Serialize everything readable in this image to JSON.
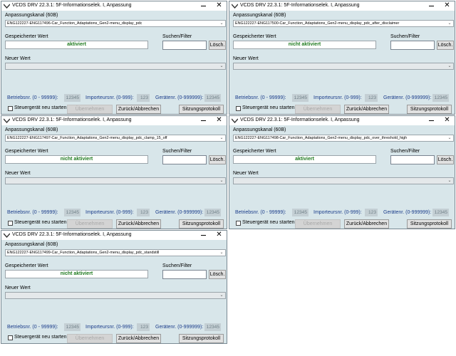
{
  "common": {
    "title": "VCDS DRV 22.3.1: 5F-Informationselek. I,  Anpassung",
    "channel_label": "Anpassungskanal (60B)",
    "stored_label": "Gespeicherter Wert",
    "search_label": "Suchen/Filter",
    "clear_btn": "Lösch.",
    "new_label": "Neuer Wert",
    "dealer_label": "Betriebsnr. (0 - 99999):",
    "dealer_value": "12345",
    "importer_label": "Importeursnr. (0-999):",
    "importer_value": "123",
    "device_label": "Gerätenr. (0-999999):",
    "device_value": "12345",
    "restart_label": "Steuergerät neu starten",
    "apply_btn": "Übernehmen",
    "back_btn": "Zurück/Abbrechen",
    "log_btn": "Sitzungsprotokoll"
  },
  "windows": [
    {
      "channel": "ENG122227-ENG117496-Car_Function_Adaptations_Gen2-menu_display_pdc",
      "stored_value": "aktiviert"
    },
    {
      "channel": "ENG122227-ENG117500-Car_Function_Adaptations_Gen2-menu_display_pdc_after_disclaimer",
      "stored_value": "nicht aktiviert"
    },
    {
      "channel": "ENG122227-ENG117497-Car_Function_Adaptations_Gen2-menu_display_pdc_clamp_15_off",
      "stored_value": "nicht aktiviert"
    },
    {
      "channel": "ENG122227-ENG117498-Car_Function_Adaptations_Gen2-menu_display_pdc_over_threshold_high",
      "stored_value": "aktiviert"
    },
    {
      "channel": "ENG122227-ENG117499-Car_Function_Adaptations_Gen2-menu_display_pdc_standstill",
      "stored_value": "nicht aktiviert"
    }
  ]
}
